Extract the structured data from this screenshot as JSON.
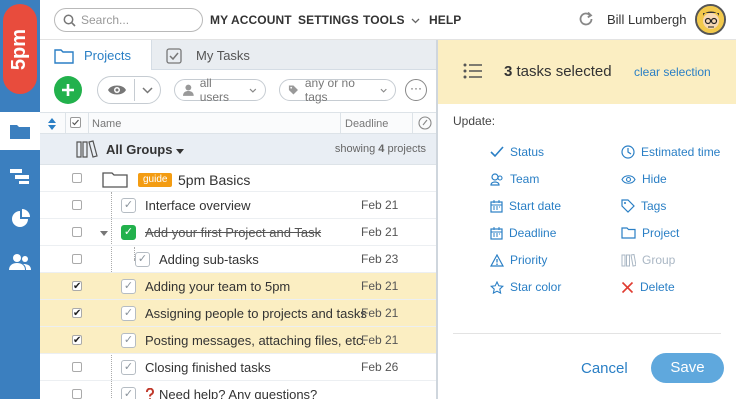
{
  "logo": {
    "text": "5pm"
  },
  "search": {
    "placeholder": "Search..."
  },
  "nav": {
    "my_account": "MY ACCOUNT",
    "settings": "SETTINGS",
    "tools": "TOOLS",
    "help": "HELP"
  },
  "user": {
    "name": "Bill Lumbergh"
  },
  "tabs": [
    {
      "label": "Projects",
      "active": true
    },
    {
      "label": "My Tasks",
      "active": false
    }
  ],
  "toolbar": {
    "users_filter": "all users",
    "tags_filter": "any or no tags",
    "more": "···"
  },
  "table": {
    "col_name": "Name",
    "col_deadline": "Deadline"
  },
  "group": {
    "title": "All Groups",
    "count_prefix": "showing ",
    "count": "4",
    "count_suffix": " projects"
  },
  "project": {
    "tag": "guide",
    "name": "5pm Basics"
  },
  "tasks": [
    {
      "name": "Interface overview",
      "date": "Feb 21",
      "selected": false,
      "done": true
    },
    {
      "name": "Add your first Project and Task",
      "date": "Feb 21",
      "selected": false,
      "done": true,
      "strike": true
    },
    {
      "name": "Adding sub-tasks",
      "date": "Feb 23",
      "selected": false,
      "done": true
    },
    {
      "name": "Adding your team to 5pm",
      "date": "Feb 21",
      "selected": true,
      "done": true
    },
    {
      "name": "Assigning people to projects and tasks",
      "date": "Feb 21",
      "selected": true,
      "done": true
    },
    {
      "name": "Posting messages, attaching files, etc.",
      "date": "Feb 21",
      "selected": true,
      "done": true
    },
    {
      "name": "Closing finished tasks",
      "date": "Feb 26",
      "selected": false,
      "done": true
    },
    {
      "name": "Need help? Any questions?",
      "date": "",
      "selected": false,
      "done": true
    }
  ],
  "panel": {
    "count": "3",
    "title_suffix": " tasks selected",
    "clear": "clear selection",
    "update_label": "Update:",
    "actions_left": [
      "Status",
      "Team",
      "Start date",
      "Deadline",
      "Priority",
      "Star color"
    ],
    "actions_right": [
      "Estimated time",
      "Hide",
      "Tags",
      "Project",
      "Group",
      "Delete"
    ],
    "cancel": "Cancel",
    "save": "Save"
  },
  "colors": {
    "accent": "#2a7fc5",
    "rail": "#3b7fbf",
    "selected_row": "#fbeec2",
    "add_button": "#22b14c",
    "guide_tag": "#f39c12",
    "delete": "#e03c31"
  }
}
